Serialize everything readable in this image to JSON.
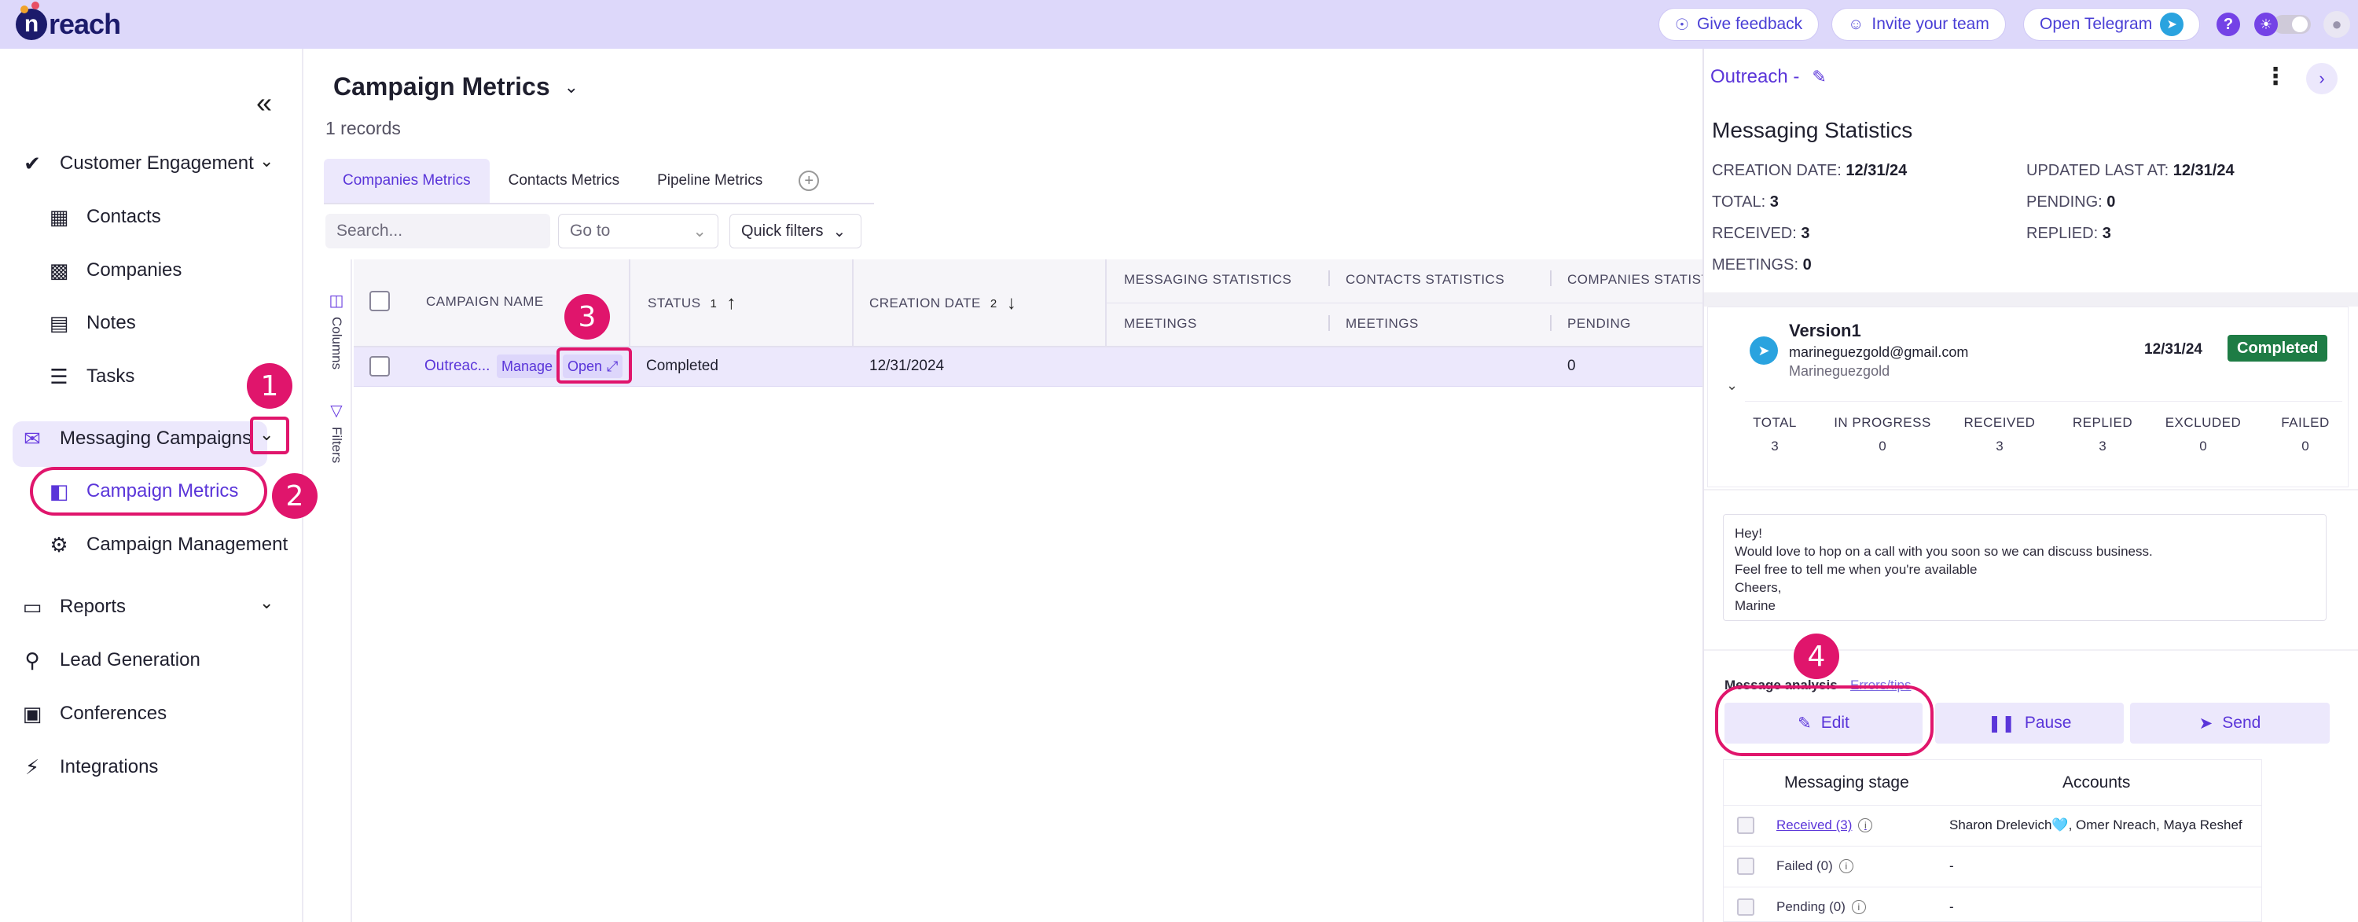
{
  "app": {
    "brand": "reach"
  },
  "topbar": {
    "feedback": "Give feedback",
    "invite": "Invite your team",
    "telegram": "Open Telegram"
  },
  "sidebar": {
    "items": [
      {
        "label": "Customer Engagement",
        "icon": "check-circle-icon"
      },
      {
        "label": "Contacts",
        "icon": "contacts-icon"
      },
      {
        "label": "Companies",
        "icon": "building-icon"
      },
      {
        "label": "Notes",
        "icon": "notes-icon"
      },
      {
        "label": "Tasks",
        "icon": "tasks-icon"
      },
      {
        "label": "Messaging Campaigns",
        "icon": "chat-bubbles-icon"
      },
      {
        "label": "Campaign Metrics",
        "icon": "bar-chart-icon"
      },
      {
        "label": "Campaign Management",
        "icon": "user-gear-icon"
      },
      {
        "label": "Reports",
        "icon": "monitor-icon"
      },
      {
        "label": "Lead Generation",
        "icon": "search-user-icon"
      },
      {
        "label": "Conferences",
        "icon": "badge-icon"
      },
      {
        "label": "Integrations",
        "icon": "plug-icon"
      }
    ]
  },
  "main": {
    "title": "Campaign Metrics",
    "records": "1 records",
    "tabs": [
      "Companies Metrics",
      "Contacts Metrics",
      "Pipeline Metrics"
    ],
    "search_placeholder": "Search...",
    "goto_placeholder": "Go to",
    "quick_filters": "Quick filters",
    "strip": {
      "columns": "Columns",
      "filters": "Filters"
    },
    "headers": {
      "campaign_name": "CAMPAIGN NAME",
      "status": "STATUS",
      "status_sort_index": "1",
      "creation_date": "CREATION DATE",
      "creation_sort_index": "2",
      "messaging_stats": "MESSAGING STATISTICS",
      "contacts_stats": "CONTACTS STATISTICS",
      "companies_stats": "COMPANIES STATIST",
      "meetings1": "MEETINGS",
      "meetings2": "MEETINGS",
      "pending": "PENDING"
    },
    "row": {
      "name": "Outreac...",
      "manage": "Manage",
      "open": "Open",
      "status": "Completed",
      "date": "12/31/2024",
      "pending": "0"
    }
  },
  "panel": {
    "header": "Outreach -",
    "title": "Messaging Statistics",
    "stats": {
      "creation_label": "CREATION DATE:",
      "creation_value": "12/31/24",
      "updated_label": "UPDATED LAST AT:",
      "updated_value": "12/31/24",
      "total_label": "TOTAL:",
      "total_value": "3",
      "pending_label": "PENDING:",
      "pending_value": "0",
      "received_label": "RECEIVED:",
      "received_value": "3",
      "replied_label": "REPLIED:",
      "replied_value": "3",
      "meetings_label": "MEETINGS:",
      "meetings_value": "0"
    },
    "version": {
      "name": "Version1",
      "email": "marineguezgold@gmail.com",
      "user": "Marineguezgold",
      "date": "12/31/24",
      "status": "Completed"
    },
    "version_stats": [
      {
        "label": "TOTAL",
        "value": "3"
      },
      {
        "label": "IN PROGRESS",
        "value": "0"
      },
      {
        "label": "RECEIVED",
        "value": "3"
      },
      {
        "label": "REPLIED",
        "value": "3"
      },
      {
        "label": "EXCLUDED",
        "value": "0"
      },
      {
        "label": "FAILED",
        "value": "0"
      }
    ],
    "message_lines": [
      "Hey!",
      "Would love to hop on a call with you soon so we can discuss business.",
      "Feel free to tell me when you're available",
      "Cheers,",
      "Marine"
    ],
    "analysis_label": "Message analysis",
    "analysis_link": "Errors/tips",
    "actions": {
      "edit": "Edit",
      "pause": "Pause",
      "send": "Send"
    },
    "stage_table": {
      "col_stage": "Messaging stage",
      "col_accounts": "Accounts",
      "rows": [
        {
          "stage": "Received (3)",
          "accounts": "Sharon Drelevich🩵, Omer Nreach, Maya Reshef"
        },
        {
          "stage": "Failed (0)",
          "accounts": "-"
        },
        {
          "stage": "Pending (0)",
          "accounts": "-"
        }
      ]
    }
  },
  "annotations": [
    "1",
    "2",
    "3",
    "4"
  ],
  "colors": {
    "accent": "#5a35d9",
    "highlight": "#e0156c",
    "topbar": "#ddd8fa",
    "completed": "#1e7c45"
  }
}
